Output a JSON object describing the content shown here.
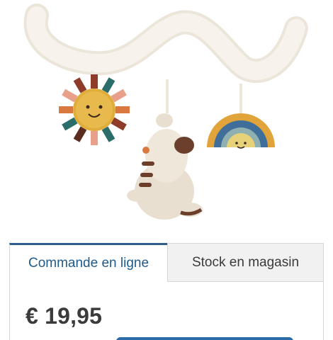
{
  "product": {
    "image_icon": "baby-spiral-toy-image",
    "price": "€ 19,95"
  },
  "tabs": [
    {
      "label": "Commande en ligne",
      "active": true
    },
    {
      "label": "Stock en magasin",
      "active": false
    }
  ],
  "colors": {
    "accent": "#2c5f8e",
    "tab_inactive_bg": "#f1f1f1",
    "price_text": "#3b3b3b"
  }
}
